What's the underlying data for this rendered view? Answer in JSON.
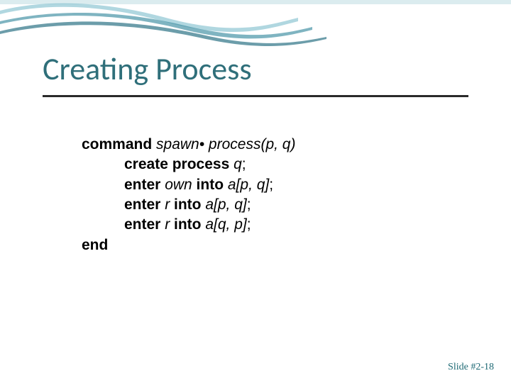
{
  "title": "Creating Process",
  "code": {
    "kw_command": "command",
    "span_spawn": " spawn• process",
    "span_args": "(p, q)",
    "l2a": "create process ",
    "l2b": "q",
    "l2c": ";",
    "l3a": "enter ",
    "l3b": "own",
    "l3c": " into ",
    "l3d": "a[p, q]",
    "l3e": ";",
    "l4a": "enter ",
    "l4b": "r",
    "l4c": " into ",
    "l4d": "a[p, q]",
    "l4e": ";",
    "l5a": "enter ",
    "l5b": "r",
    "l5c": " into ",
    "l5d": "a[q, p]",
    "l5e": ";",
    "kw_end": "end"
  },
  "footer": "Slide #2-18"
}
